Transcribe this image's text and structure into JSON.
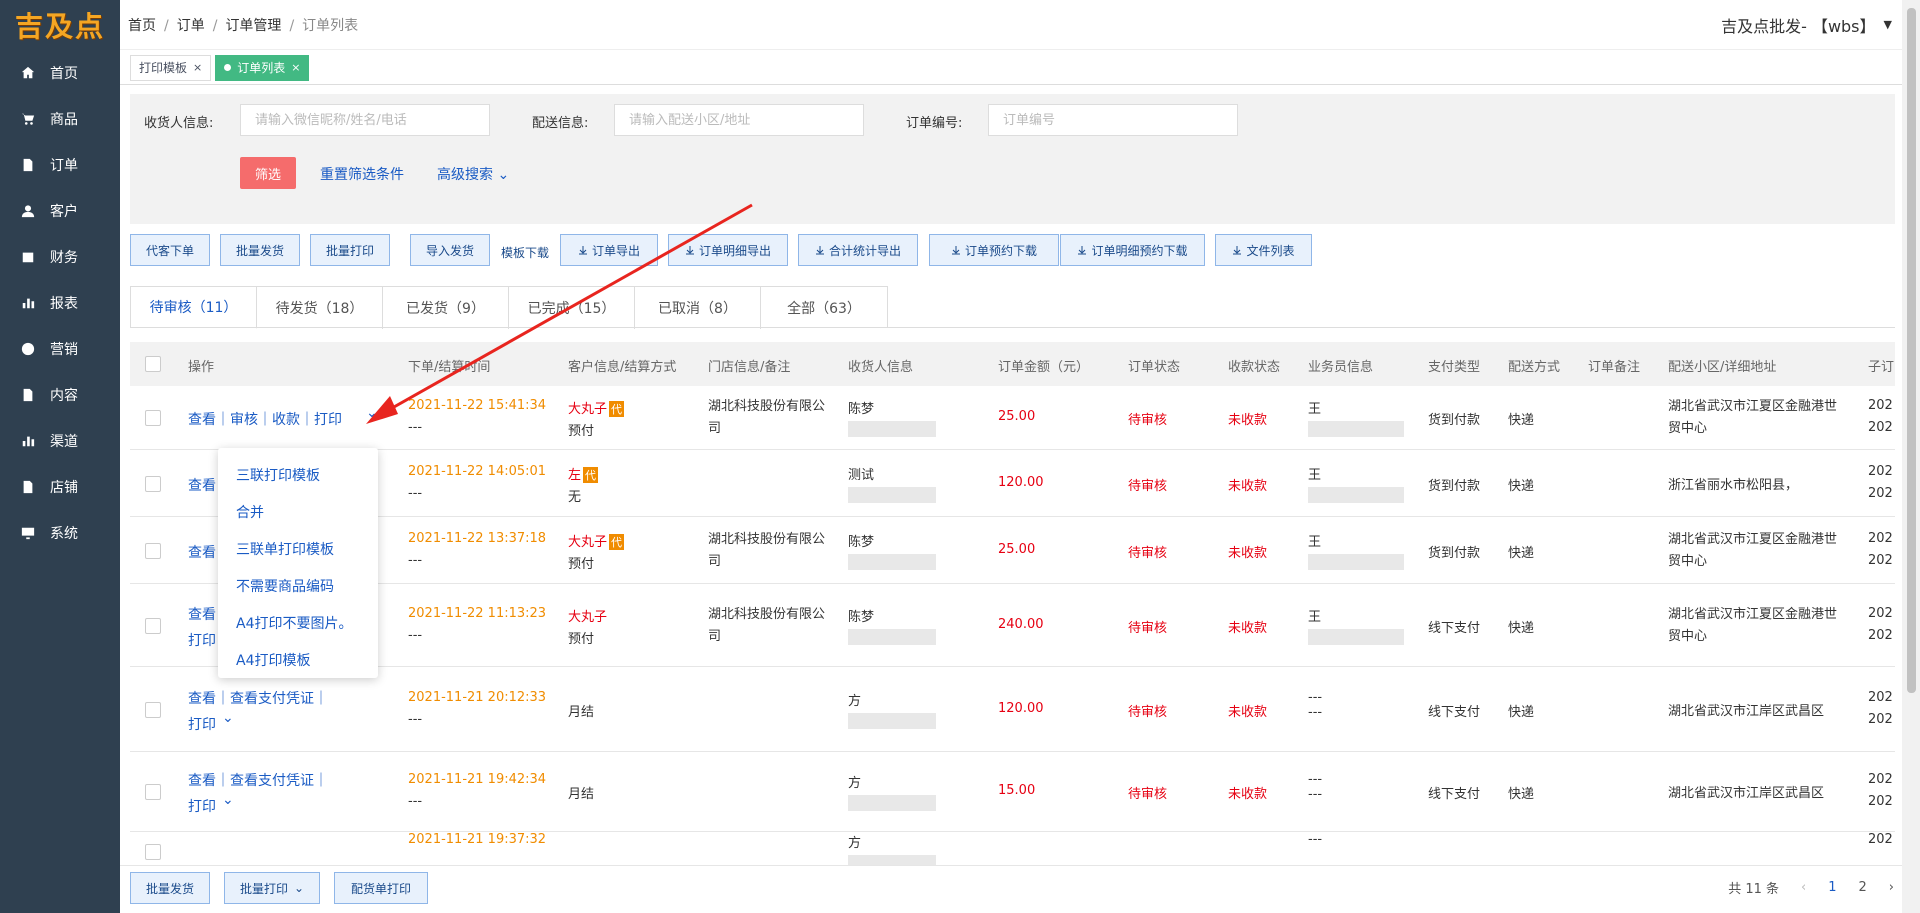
{
  "logo": "吉及点",
  "nav": [
    "首页",
    "商品",
    "订单",
    "客户",
    "财务",
    "报表",
    "营销",
    "内容",
    "渠道",
    "店铺",
    "系统"
  ],
  "breadcrumb": [
    "首页",
    "订单",
    "订单管理",
    "订单列表"
  ],
  "user": "吉及点批发- 【wbs】",
  "open_tabs": [
    "打印模板",
    "订单列表"
  ],
  "filters": {
    "receiver_label": "收货人信息:",
    "receiver_placeholder": "请输入微信昵称/姓名/电话",
    "delivery_label": "配送信息:",
    "delivery_placeholder": "请输入配送小区/地址",
    "order_no_label": "订单编号:",
    "order_no_placeholder": "订单编号",
    "filter_button": "筛选",
    "reset": "重置筛选条件",
    "advanced": "高级搜索"
  },
  "toolbar": {
    "place_order": "代客下单",
    "batch_ship": "批量发货",
    "batch_print": "批量打印",
    "import_ship": "导入发货",
    "template_download": "模板下载",
    "export_orders": "订单导出",
    "export_details": "订单明细导出",
    "export_totals": "合计统计导出",
    "download_booking": "订单预约下载",
    "download_detail_booking": "订单明细预约下载",
    "file_list": "文件列表"
  },
  "status_tabs": [
    "待审核（11）",
    "待发货（18）",
    "已发货（9）",
    "已完成（15）",
    "已取消（8）",
    "全部（63）"
  ],
  "columns": [
    "操作",
    "下单/结算时间",
    "客户信息/结算方式",
    "门店信息/备注",
    "收货人信息",
    "订单金额（元）",
    "订单状态",
    "收款状态",
    "业务员信息",
    "支付类型",
    "配送方式",
    "订单备注",
    "配送小区/详细地址",
    "子订"
  ],
  "rows": [
    {
      "ops": "查看｜审核｜收款｜打印",
      "time": "2021-11-22 15:41:34",
      "time2": "---",
      "customer": "大丸子",
      "dai": "代",
      "settle": "预付",
      "store": "湖北科技股份有限公司",
      "receiver": "陈梦",
      "amount": "25.00",
      "status": "待审核",
      "pay_status": "未收款",
      "sales": "王",
      "pay_type": "货到付款",
      "ship": "快递",
      "address": "湖北省武汉市江夏区金融港世贸中心",
      "sub1": "202",
      "sub2": "202"
    },
    {
      "ops": "查看",
      "time": "2021-11-22 14:05:01",
      "time2": "---",
      "customer": "左",
      "dai": "代",
      "settle": "无",
      "store": "",
      "receiver": "测试",
      "amount": "120.00",
      "status": "待审核",
      "pay_status": "未收款",
      "sales": "王",
      "pay_type": "货到付款",
      "ship": "快递",
      "address": "浙江省丽水市松阳县，",
      "sub1": "202",
      "sub2": "202"
    },
    {
      "ops": "查看",
      "time": "2021-11-22 13:37:18",
      "time2": "---",
      "customer": "大丸子",
      "dai": "代",
      "settle": "预付",
      "store": "湖北科技股份有限公司",
      "receiver": "陈梦",
      "amount": "25.00",
      "status": "待审核",
      "pay_status": "未收款",
      "sales": "王",
      "pay_type": "货到付款",
      "ship": "快递",
      "address": "湖北省武汉市江夏区金融港世贸中心",
      "sub1": "202",
      "sub2": "202"
    },
    {
      "ops": "查看",
      "ops2": "打印",
      "time": "2021-11-22 11:13:23",
      "time2": "---",
      "customer": "大丸子",
      "dai": "",
      "settle": "预付",
      "store": "湖北科技股份有限公司",
      "receiver": "陈梦",
      "amount": "240.00",
      "status": "待审核",
      "pay_status": "未收款",
      "sales": "王",
      "pay_type": "线下支付",
      "ship": "快递",
      "address": "湖北省武汉市江夏区金融港世贸中心",
      "sub1": "202",
      "sub2": "202"
    },
    {
      "ops": "查看｜查看支付凭证｜",
      "ops2": "打印",
      "time": "2021-11-21 20:12:33",
      "time2": "---",
      "customer": "",
      "dai": "",
      "settle": "月结",
      "store": "",
      "receiver": "方",
      "amount": "120.00",
      "status": "待审核",
      "pay_status": "未收款",
      "sales": "---",
      "sales2": "---",
      "pay_type": "线下支付",
      "ship": "快递",
      "address": "湖北省武汉市江岸区武昌区",
      "sub1": "202",
      "sub2": "202"
    },
    {
      "ops": "查看｜查看支付凭证｜",
      "ops2": "打印",
      "time": "2021-11-21 19:42:34",
      "time2": "---",
      "customer": "",
      "dai": "",
      "settle": "月结",
      "store": "",
      "receiver": "方",
      "amount": "15.00",
      "status": "待审核",
      "pay_status": "未收款",
      "sales": "---",
      "sales2": "---",
      "pay_type": "线下支付",
      "ship": "快递",
      "address": "湖北省武汉市江岸区武昌区",
      "sub1": "202",
      "sub2": "202"
    },
    {
      "ops": "",
      "time": "2021-11-21 19:37:32",
      "time2": "",
      "customer": "",
      "dai": "",
      "settle": "",
      "store": "",
      "receiver": "方",
      "amount": "",
      "status": "",
      "pay_status": "",
      "sales": "---",
      "pay_type": "",
      "ship": "",
      "address": "",
      "sub1": "202",
      "sub2": ""
    }
  ],
  "print_menu": [
    "三联打印模板",
    "合并",
    "三联单打印模板",
    "不需要商品编码",
    "A4打印不要图片。",
    "A4打印模板"
  ],
  "footer": {
    "batch_ship": "批量发货",
    "batch_print": "批量打印",
    "dispatch_print": "配货单打印",
    "total": "共 11 条",
    "pages": [
      "1",
      "2"
    ]
  },
  "colors": {
    "sidebar": "#2f4050",
    "accent": "#1a5bc4",
    "active_tag": "#42b983",
    "danger": "#e60012",
    "time": "#f08c00"
  }
}
